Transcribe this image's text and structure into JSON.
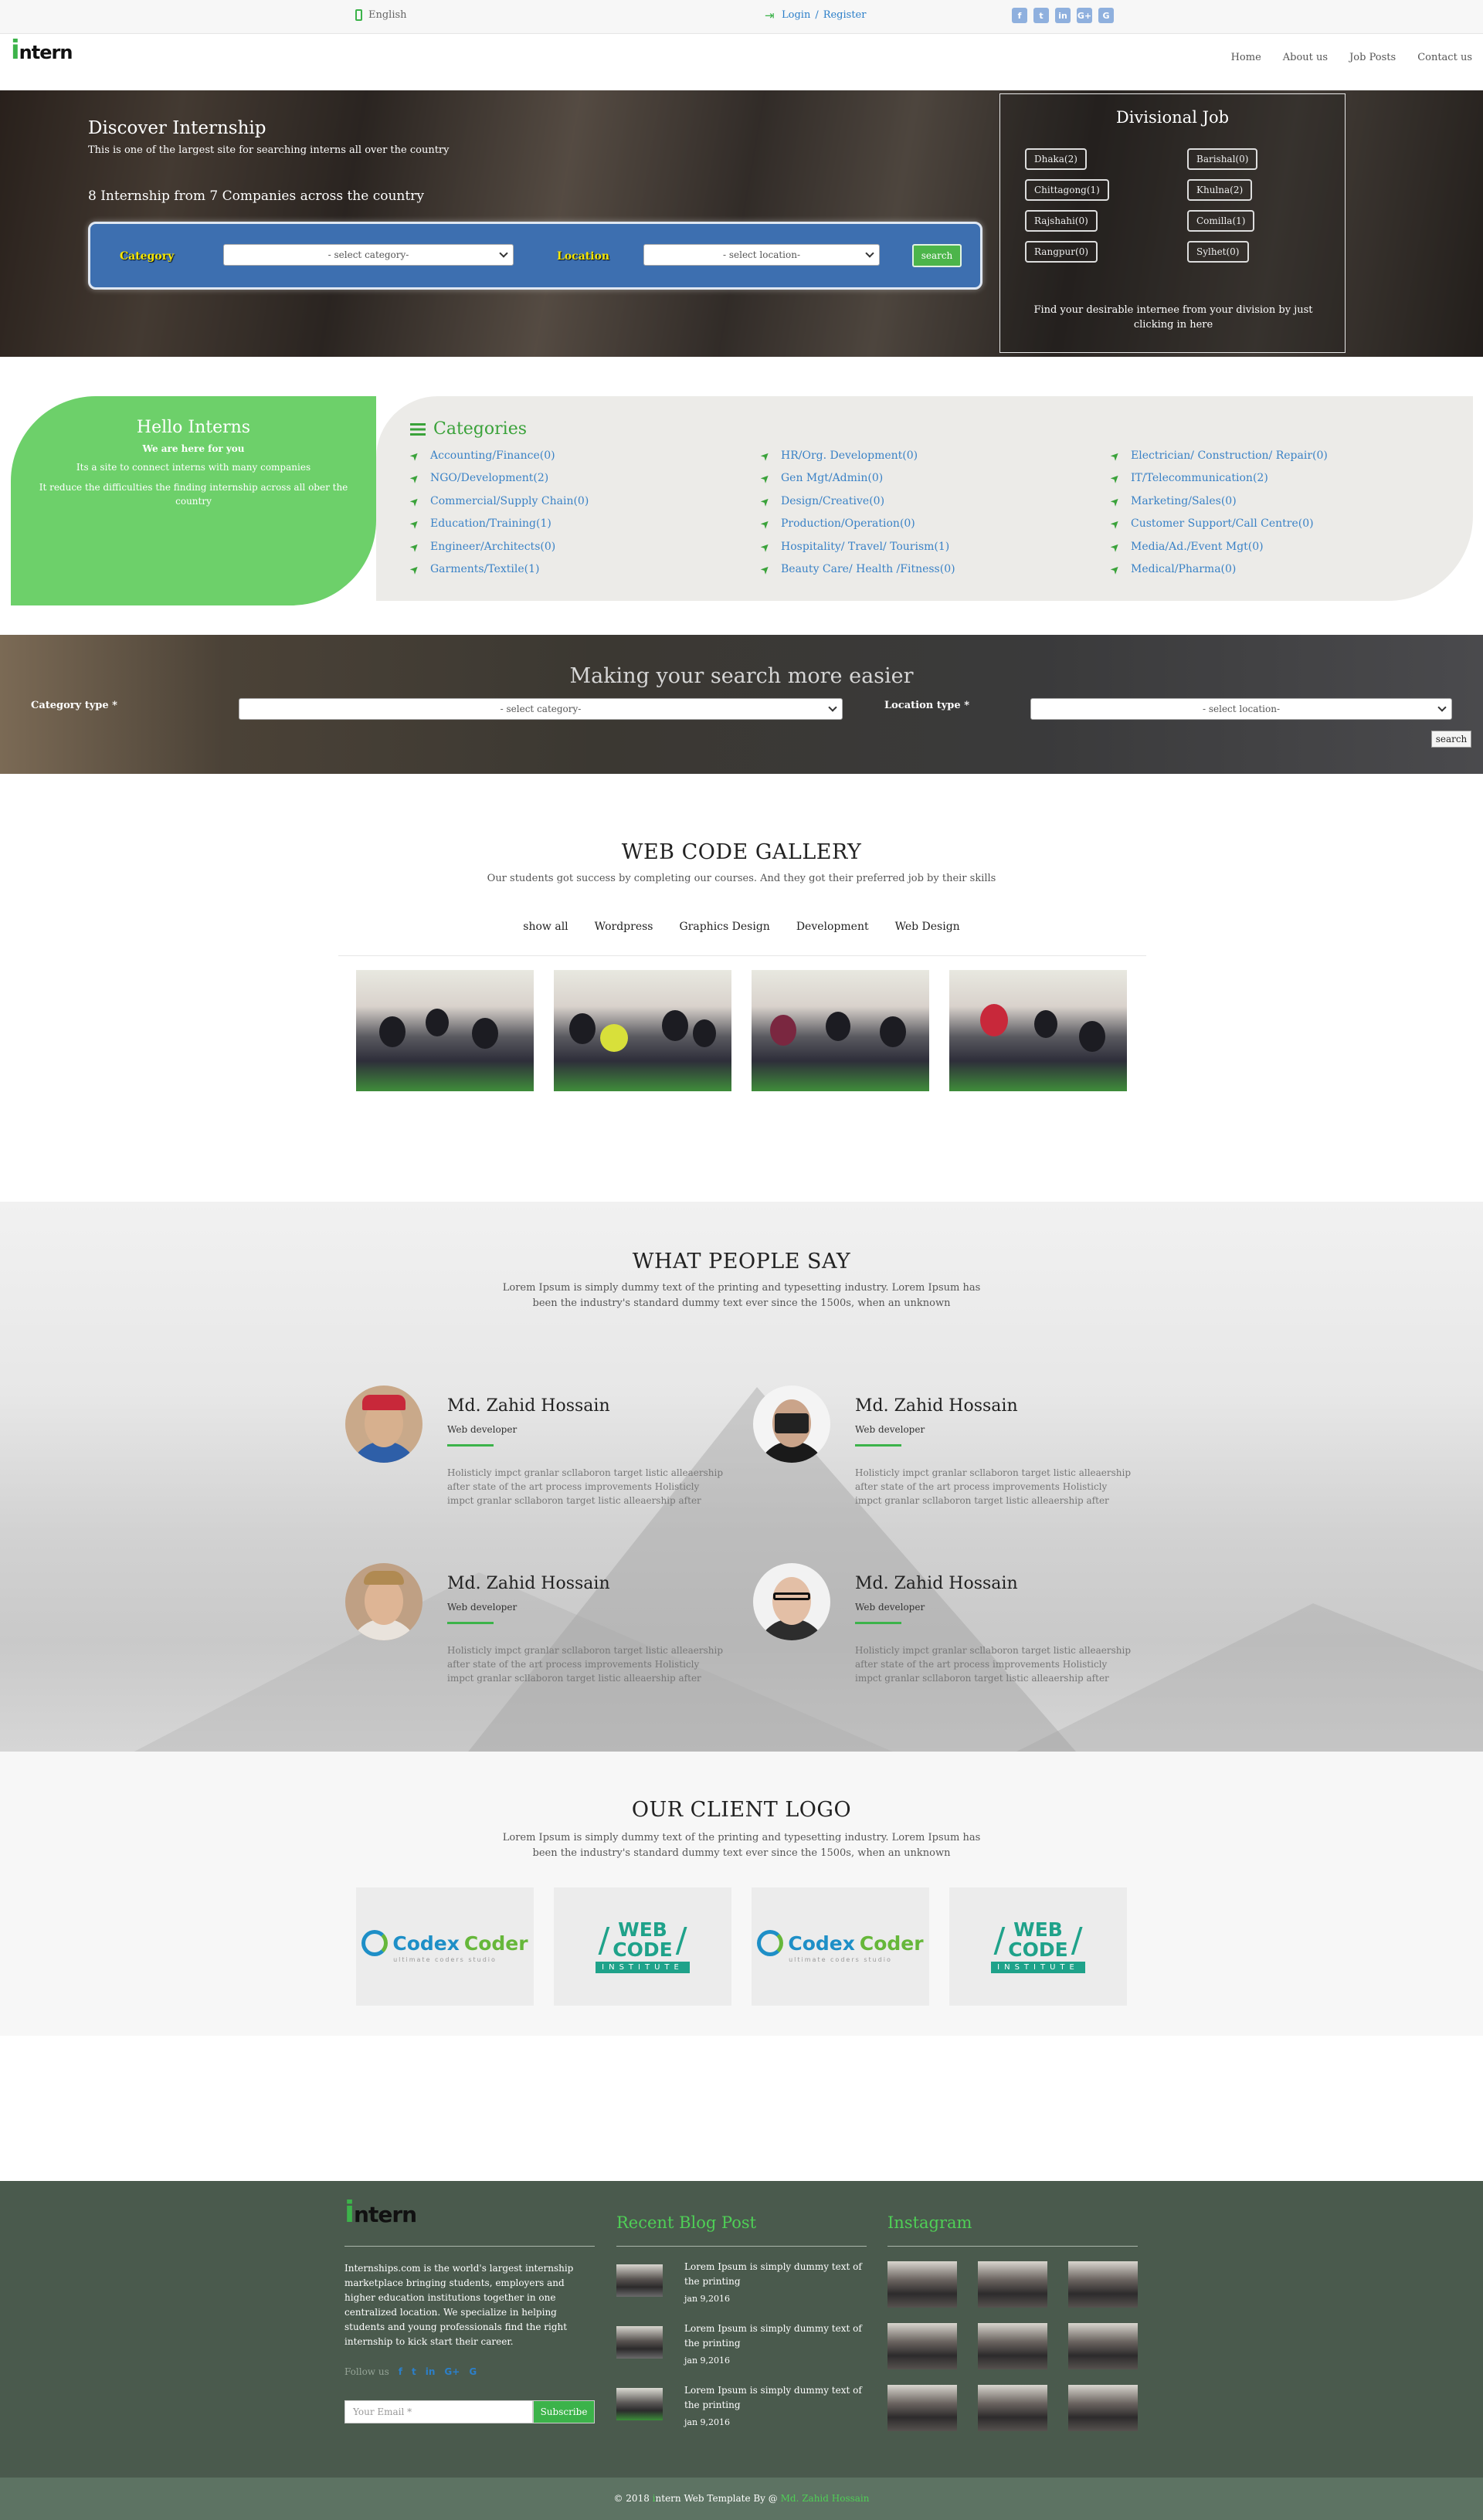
{
  "topbar": {
    "language": "English",
    "login": "Login",
    "separator": "/",
    "register": "Register",
    "social_icons": [
      "facebook-icon",
      "twitter-icon",
      "linkedin-icon",
      "google-plus-icon",
      "google-icon"
    ],
    "social_glyphs": [
      "f",
      "t",
      "in",
      "G+",
      "G"
    ]
  },
  "nav": {
    "logo_i": "i",
    "logo_text": "ntern",
    "menu": [
      "Home",
      "About us",
      "Job Posts",
      "Contact us"
    ]
  },
  "hero": {
    "title": "Discover Internship",
    "subtitle": "This is one of the largest site for searching interns all over the country",
    "count_text": "8 Internship from 7 Companies across the country",
    "category_label": "Category",
    "category_placeholder": "- select category-",
    "location_label": "Location",
    "location_placeholder": "- select location-",
    "search_label": "search",
    "divisional": {
      "title": "Divisional Job",
      "divisions": [
        "Dhaka(2)",
        "Barishal(0)",
        "Chittagong(1)",
        "Khulna(2)",
        "Rajshahi(0)",
        "Comilla(1)",
        "Rangpur(0)",
        "Sylhet(0)"
      ],
      "note": "Find your desirable internee from your division by just clicking in here"
    }
  },
  "hello": {
    "title": "Hello Interns",
    "line1": "We are here for you",
    "line2": "Its a site to connect interns with many companies",
    "line3": "It reduce the difficulties the finding internship across all ober the country"
  },
  "categories": {
    "title": "Categories",
    "col1": [
      "Accounting/Finance(0)",
      "NGO/Development(2)",
      "Commercial/Supply Chain(0)",
      "Education/Training(1)",
      "Engineer/Architects(0)",
      "Garments/Textile(1)"
    ],
    "col2": [
      "HR/Org. Development(0)",
      "Gen Mgt/Admin(0)",
      "Design/Creative(0)",
      "Production/Operation(0)",
      "Hospitality/ Travel/ Tourism(1)",
      "Beauty Care/ Health /Fitness(0)"
    ],
    "col3": [
      "Electrician/ Construction/ Repair(0)",
      "IT/Telecommunication(2)",
      "Marketing/Sales(0)",
      "Customer Support/Call Centre(0)",
      "Media/Ad./Event Mgt(0)",
      "Medical/Pharma(0)"
    ]
  },
  "easier": {
    "title": "Making your search more easier",
    "category_label": "Category type *",
    "category_placeholder": "- select category-",
    "location_label": "Location type *",
    "location_placeholder": "- select location-",
    "search_label": "search"
  },
  "gallery": {
    "title": "WEB CODE GALLERY",
    "subtitle": "Our students got success by completing our courses. And they got their preferred job by their skills",
    "filters": [
      "show all",
      "Wordpress",
      "Graphics Design",
      "Development",
      "Web Design"
    ]
  },
  "testimonials": {
    "title": "WHAT PEOPLE SAY",
    "subtitle": "Lorem Ipsum is simply dummy text of the printing and typesetting industry. Lorem Ipsum has been the industry's standard dummy text ever since the 1500s, when an unknown",
    "items": [
      {
        "name": "Md. Zahid Hossain",
        "role": "Web developer",
        "text": "Holisticly impct granlar scllaboron target listic alleaership after state of the art process improvements Holisticly impct granlar scllaboron target listic alleaership after"
      },
      {
        "name": "Md. Zahid Hossain",
        "role": "Web developer",
        "text": "Holisticly impct granlar scllaboron target listic alleaership after state of the art process improvements Holisticly impct granlar scllaboron target listic alleaership after"
      },
      {
        "name": "Md. Zahid Hossain",
        "role": "Web developer",
        "text": "Holisticly impct granlar scllaboron target listic alleaership after state of the art process improvements Holisticly impct granlar scllaboron target listic alleaership after"
      },
      {
        "name": "Md. Zahid Hossain",
        "role": "Web developer",
        "text": "Holisticly impct granlar scllaboron target listic alleaership after state of the art process improvements Holisticly impct granlar scllaboron target listic alleaership after"
      }
    ]
  },
  "clients": {
    "title": "OUR CLIENT LOGO",
    "subtitle": "Lorem Ipsum is simply dummy text of the printing and typesetting industry. Lorem Ipsum has been the industry's standard dummy text ever since the 1500s, when an unknown",
    "codex_part1": "Codex",
    "codex_part2": "Coder",
    "codex_tagline": "ultimate coders studio",
    "webcode_left": "/",
    "webcode_right": "/",
    "webcode_web": "WEB",
    "webcode_code": "CODE",
    "webcode_institute": "INSTITUTE"
  },
  "footer": {
    "logo_i": "i",
    "logo_text": "ntern",
    "about": "Internships.com is the world's largest internship marketplace bringing students, employers and higher education institutions together in one centralized location. We specialize in helping students and young professionals find the right internship to kick start their career.",
    "follow_label": "Follow us",
    "follow_glyphs": [
      "f",
      "t",
      "in",
      "G+",
      "G"
    ],
    "email_placeholder": "Your Email *",
    "subscribe_label": "Subscribe",
    "blog_title": "Recent Blog Post",
    "posts": [
      {
        "title": "Lorem Ipsum is simply dummy text of the printing",
        "date": "jan 9,2016"
      },
      {
        "title": "Lorem Ipsum is simply dummy text of the printing",
        "date": "jan 9,2016"
      },
      {
        "title": "Lorem Ipsum is simply dummy text of the printing",
        "date": "jan 9,2016"
      }
    ],
    "instagram_title": "Instagram",
    "copyright_prefix": "© 2018",
    "copyright_brand_i": "i",
    "copyright_brand": "ntern Web Template By @",
    "copyright_author": "Md. Zahid Hossain"
  },
  "colors": {
    "accent_green": "#3cb34a",
    "link_blue": "#3a82c6",
    "hello_green": "#6dd06a",
    "footer_bg": "#4a5a4d"
  }
}
